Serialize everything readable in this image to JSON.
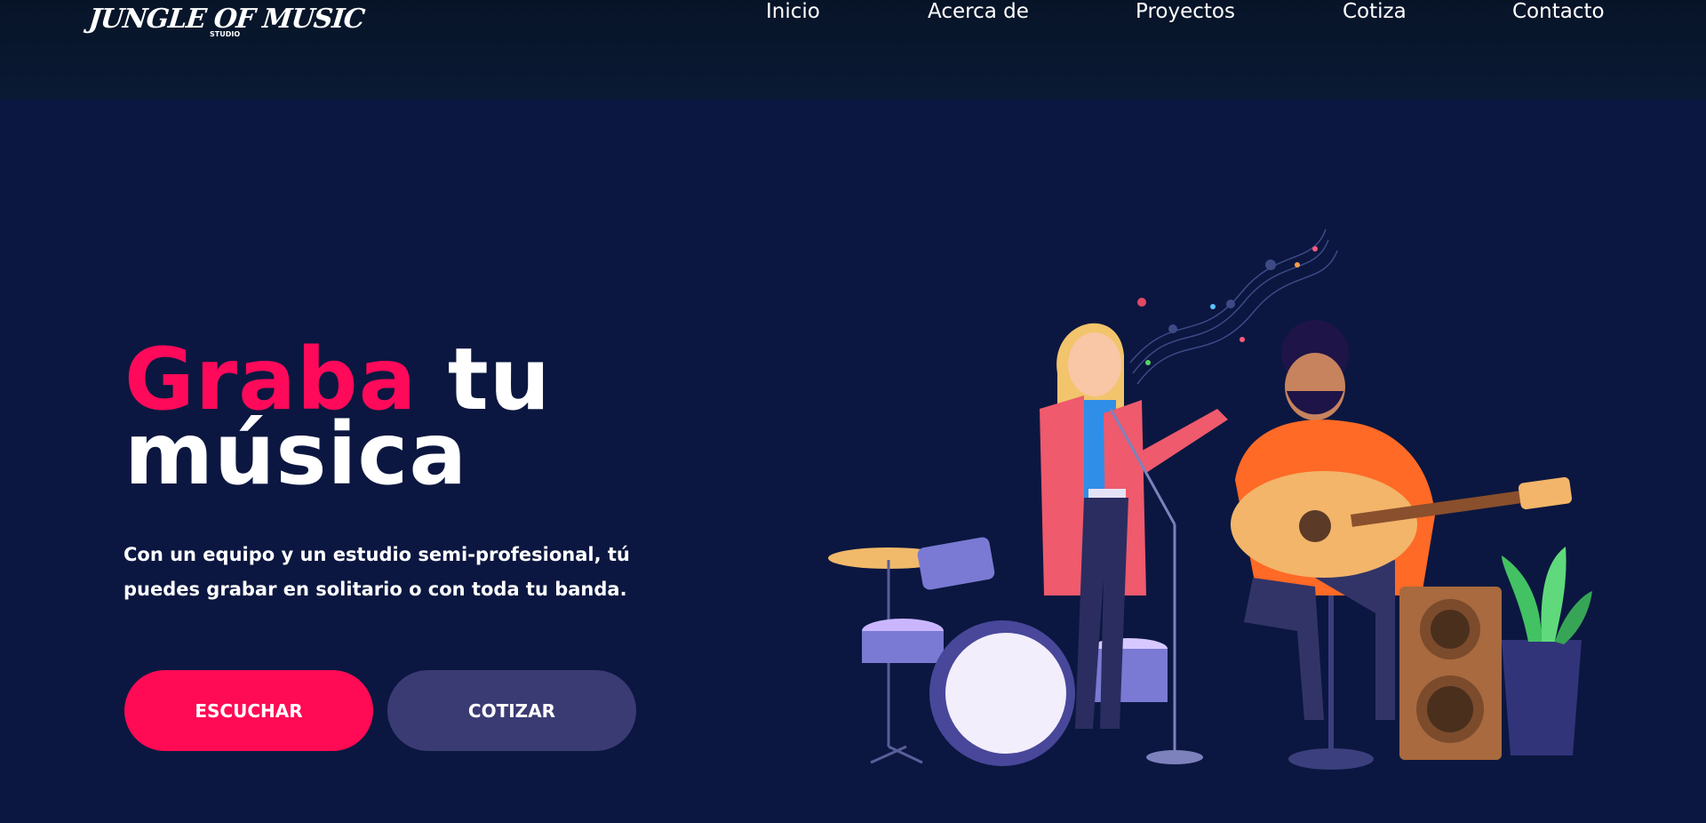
{
  "brand": {
    "logo_text": "JUNGLE OF MUSIC",
    "logo_sub": "STUDIO"
  },
  "nav": {
    "items": [
      {
        "label": "Inicio"
      },
      {
        "label": "Acerca de"
      },
      {
        "label": "Proyectos"
      },
      {
        "label": "Cotiza"
      },
      {
        "label": "Contacto"
      }
    ]
  },
  "hero": {
    "title_accent": "Graba",
    "title_rest": " tu",
    "title_line2": "música",
    "description": "Con un equipo y un estudio semi-profesional, tú puedes grabar en solitario o con toda tu banda.",
    "primary_button": "ESCUCHAR",
    "secondary_button": "COTIZAR"
  },
  "colors": {
    "background": "#0b1740",
    "header": "#071428",
    "accent": "#ff0a54",
    "secondary_button": "#3b3b74"
  }
}
